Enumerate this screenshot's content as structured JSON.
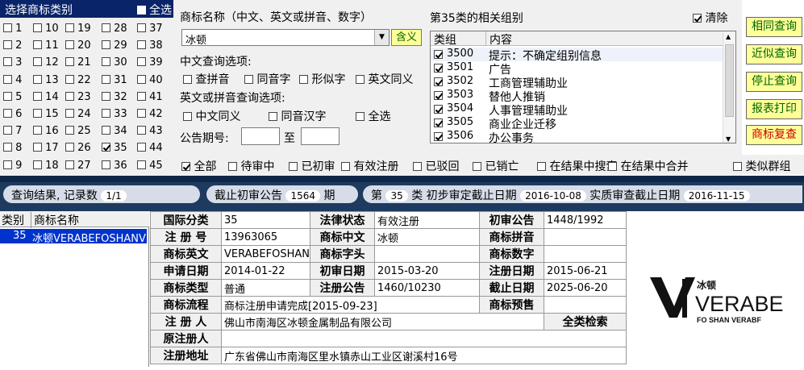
{
  "class_panel": {
    "title": "选择商标类别",
    "select_all": "全选",
    "classes": [
      "1",
      "2",
      "3",
      "4",
      "5",
      "6",
      "7",
      "8",
      "9",
      "10",
      "11",
      "12",
      "13",
      "14",
      "15",
      "16",
      "17",
      "18",
      "19",
      "20",
      "21",
      "22",
      "23",
      "24",
      "25",
      "26",
      "27",
      "28",
      "29",
      "30",
      "31",
      "32",
      "33",
      "34",
      "35",
      "36",
      "37",
      "38",
      "39",
      "40",
      "41",
      "42",
      "43",
      "44",
      "45"
    ],
    "checked_class": "35"
  },
  "search": {
    "name_label": "商标名称（中文、英文或拼音、数字）",
    "name_value": "冰顿",
    "meaning_button": "含义",
    "cn_options_label": "中文查询选项:",
    "cn_options": [
      "查拼音",
      "同音字",
      "形似字",
      "英文同义"
    ],
    "en_options_label": "英文或拼音查询选项:",
    "en_options": [
      "中文同义",
      "同音汉字",
      "全选"
    ],
    "announce_label": "公告期号:",
    "announce_to": "至"
  },
  "groups": {
    "title": "第35类的相关组别",
    "clear": "清除",
    "col_group": "类组",
    "col_content": "内容",
    "rows": [
      {
        "code": "3500",
        "text": "提示：不确定组别信息"
      },
      {
        "code": "3501",
        "text": "广告"
      },
      {
        "code": "3502",
        "text": "工商管理辅助业"
      },
      {
        "code": "3503",
        "text": "替他人推销"
      },
      {
        "code": "3504",
        "text": "人事管理辅助业"
      },
      {
        "code": "3505",
        "text": "商业企业迁移"
      },
      {
        "code": "3506",
        "text": "办公事务"
      }
    ]
  },
  "buttons": {
    "exact": "相同查询",
    "similar": "近似查询",
    "stop": "停止查询",
    "report": "报表打印",
    "review": "商标复查"
  },
  "status_filters": [
    "全部",
    "待审中",
    "已初审",
    "有效注册",
    "已驳回",
    "已销亡",
    "在结果中搜索",
    "在结果中合并",
    "类似群组"
  ],
  "band": {
    "result_label": "查询结果, 记录数",
    "result_count": "1/1",
    "cutoff_label": "截止初审公告",
    "cutoff_value": "1564",
    "cutoff_unit": "期",
    "class_prefix": "第",
    "class_value": "35",
    "class_suffix": "类",
    "prelim_label": "初步审定截止日期",
    "prelim_date": "2016-10-08",
    "exam_label": "实质审查截止日期",
    "exam_date": "2016-11-15"
  },
  "result_list": {
    "col_class": "类别",
    "col_name": "商标名称",
    "row_class": "35",
    "row_name": "冰顿VERABEFOSHANVI"
  },
  "detail": {
    "intl_class_label": "国际分类",
    "intl_class": "35",
    "legal_status_label": "法律状态",
    "legal_status": "有效注册",
    "prelim_ann_label": "初审公告",
    "prelim_ann": "1448/1992",
    "reg_no_label": "注 册 号",
    "reg_no": "13963065",
    "cn_name_label": "商标中文",
    "cn_name": "冰顿",
    "pinyin_label": "商标拼音",
    "pinyin": "",
    "en_name_label": "商标英文",
    "en_name": "VERABEFOSHANV",
    "prefix_label": "商标字头",
    "prefix": "",
    "digits_label": "商标数字",
    "digits": "",
    "apply_date_label": "申请日期",
    "apply_date": "2014-01-22",
    "prelim_date_label": "初审日期",
    "prelim_date": "2015-03-20",
    "reg_date_label": "注册日期",
    "reg_date": "2015-06-21",
    "type_label": "商标类型",
    "type": "普通",
    "reg_ann_label": "注册公告",
    "reg_ann": "1460/10230",
    "expiry_label": "截止日期",
    "expiry": "2025-06-20",
    "flow_label": "商标流程",
    "flow": "商标注册申请完成[2015-09-23]",
    "preview_label": "商标预售",
    "preview": "",
    "registrant_label": "注 册 人",
    "registrant": "佛山市南海区冰顿金属制品有限公司",
    "all_class_search": "全类检索",
    "orig_registrant_label": "原注册人",
    "orig_registrant": "",
    "address_label": "注册地址",
    "address": "广东省佛山市南海区里水镇赤山工业区谢溪村16号"
  },
  "logo": {
    "cn": "冰顿",
    "main": "VERABE",
    "sub": "FO SHAN VERABF"
  }
}
